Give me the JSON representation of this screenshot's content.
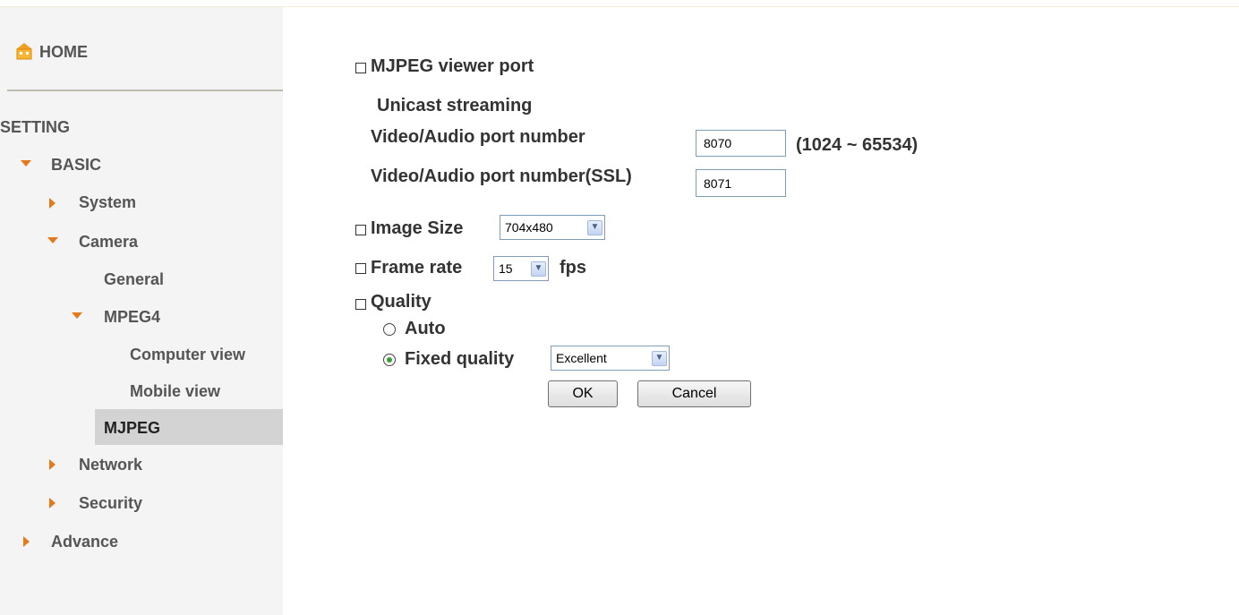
{
  "sidebar": {
    "home_label": "HOME",
    "setting_label": "SETTING",
    "basic_label": "BASIC",
    "system_label": "System",
    "camera_label": "Camera",
    "general_label": "General",
    "mpeg4_label": "MPEG4",
    "computer_view_label": "Computer view",
    "mobile_view_label": "Mobile view",
    "mjpeg_label": "MJPEG",
    "network_label": "Network",
    "security_label": "Security",
    "advance_label": "Advance",
    "active_item": "MJPEG"
  },
  "form": {
    "viewer_port_title": "MJPEG viewer port",
    "unicast_label": "Unicast streaming",
    "port_label": "Video/Audio port number",
    "port_value": "8070",
    "port_range": "(1024 ~ 65534)",
    "ssl_port_label": "Video/Audio port number(SSL)",
    "ssl_port_value": "8071",
    "image_size_label": "Image Size",
    "image_size_value": "704x480",
    "frame_rate_label": "Frame rate",
    "frame_rate_value": "15",
    "fps_label": "fps",
    "quality_label": "Quality",
    "auto_label": "Auto",
    "fixed_quality_label": "Fixed quality",
    "fixed_quality_value": "Excellent",
    "selected_quality_mode": "Fixed quality",
    "ok_label": "OK",
    "cancel_label": "Cancel"
  },
  "colors": {
    "accent": "#e27a1b",
    "sidebar_bg": "#f4f4f4",
    "active_bg": "#d3d3d3"
  }
}
